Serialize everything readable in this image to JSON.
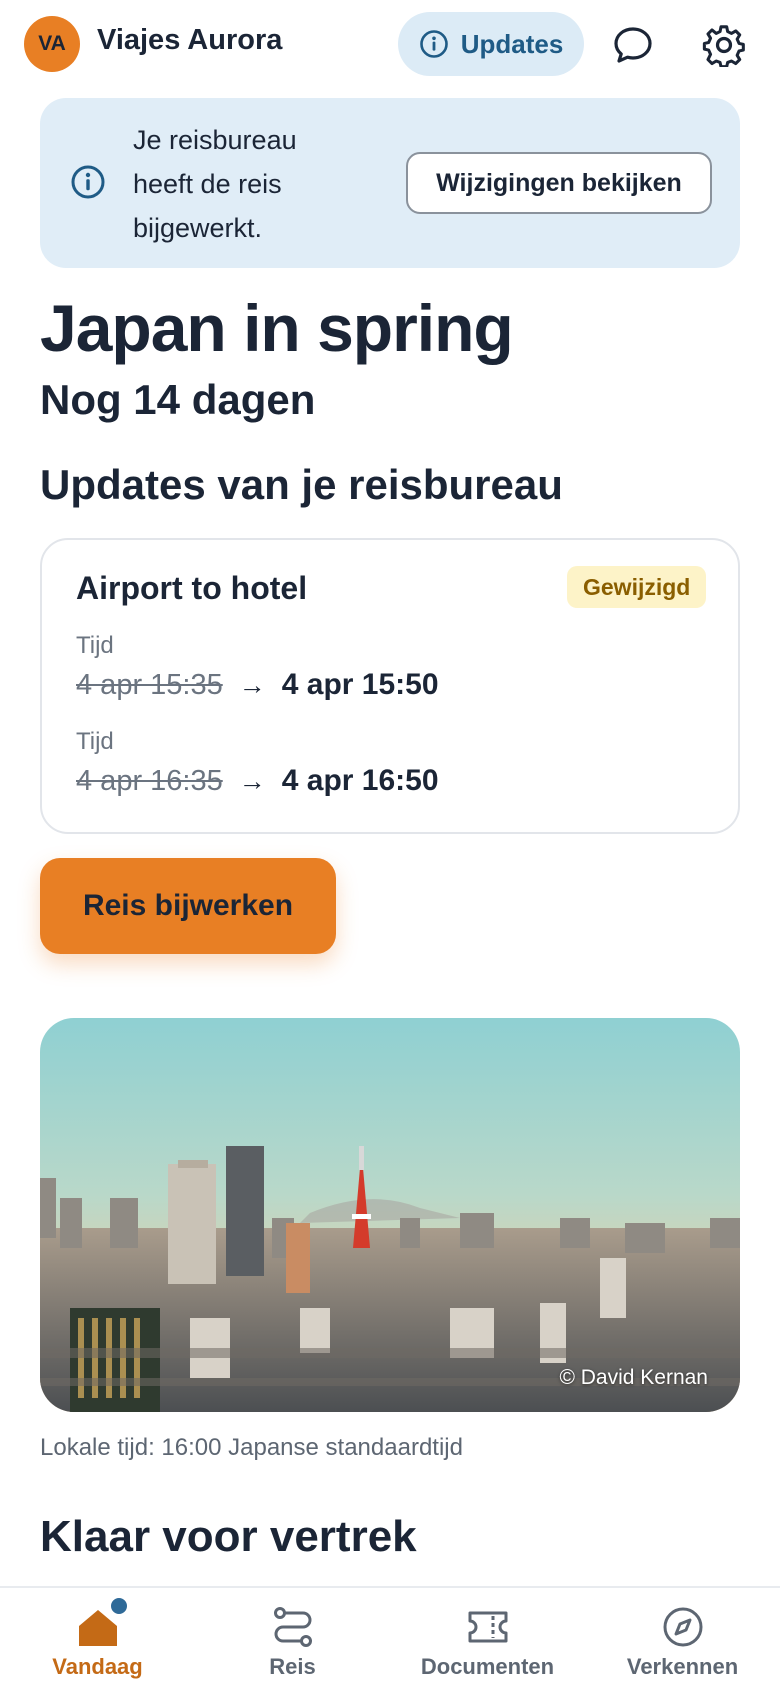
{
  "header": {
    "avatar_initials": "VA",
    "agency_name": "Viajes Aurora",
    "updates_label": "Updates",
    "icons": [
      "info-icon",
      "chat-bubble-icon",
      "gear-icon"
    ]
  },
  "banner": {
    "text": "Je reisbureau heeft de reis bijgewerkt.",
    "button_label": "Wijzigingen bekijken"
  },
  "trip": {
    "title": "Japan in spring",
    "countdown": "Nog 14 dagen"
  },
  "updates_section": {
    "heading": "Updates van je reisbureau",
    "card": {
      "title": "Airport to hotel",
      "badge": "Gewijzigd",
      "changes": [
        {
          "label": "Tijd",
          "old": "4 apr 15:35",
          "arrow": "→",
          "new": "4 apr 15:50"
        },
        {
          "label": "Tijd",
          "old": "4 apr 16:35",
          "arrow": "→",
          "new": "4 apr 16:50"
        }
      ]
    },
    "cta_label": "Reis bijwerken"
  },
  "photo": {
    "credit": "© David Kernan"
  },
  "local_time": "Lokale tijd: 16:00 Japanse standaardtijd",
  "next_section_heading": "Klaar voor vertrek",
  "nav": {
    "items": [
      {
        "label": "Vandaag",
        "icon": "home-icon",
        "active": true
      },
      {
        "label": "Reis",
        "icon": "route-icon",
        "active": false
      },
      {
        "label": "Documenten",
        "icon": "ticket-icon",
        "active": false
      },
      {
        "label": "Verkennen",
        "icon": "compass-icon",
        "active": false
      }
    ]
  },
  "colors": {
    "accent": "#e87f24",
    "info_blue": "#1f5b86",
    "banner_bg": "#e0edf7",
    "badge_bg": "#fdf3c8",
    "text": "#1b2536"
  }
}
